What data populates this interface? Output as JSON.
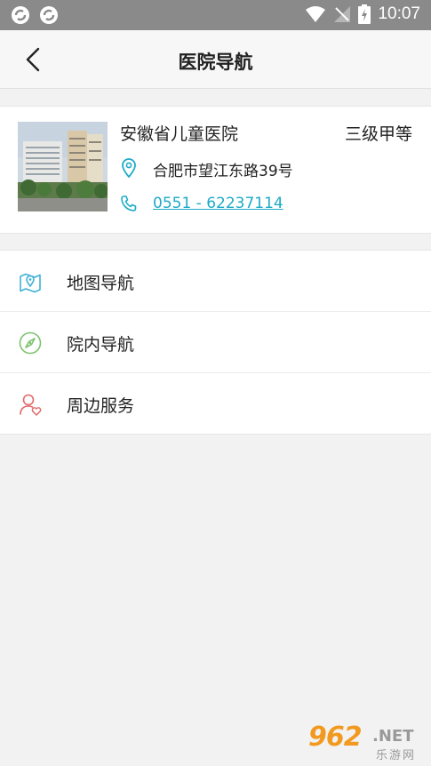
{
  "status_bar": {
    "time": "10:07"
  },
  "header": {
    "title": "医院导航"
  },
  "hospital": {
    "name": "安徽省儿童医院",
    "level": "三级甲等",
    "address": "合肥市望江东路39号",
    "phone": "0551 - 62237114"
  },
  "menu": {
    "items": [
      {
        "label": "地图导航",
        "icon": "map-pin-icon"
      },
      {
        "label": "院内导航",
        "icon": "compass-icon"
      },
      {
        "label": "周边服务",
        "icon": "user-heart-icon"
      }
    ]
  },
  "watermark": {
    "number": "962",
    "suffix": ".NET",
    "text": "乐游网"
  },
  "colors": {
    "accent": "#1cabc7",
    "map_icon": "#3fb1d6",
    "compass_icon": "#7fc26f",
    "service_icon": "#e26a6a"
  }
}
